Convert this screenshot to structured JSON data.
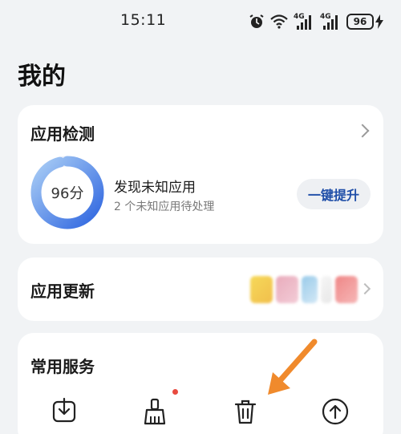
{
  "status_bar": {
    "time": "15:11",
    "icons": [
      "alarm-icon",
      "wifi-icon",
      "signal-4g-icon",
      "signal-4g-icon",
      "charging-icon"
    ],
    "signal_label_1": "4G",
    "signal_label_2": "4G",
    "battery": "96"
  },
  "page": {
    "title": "我的"
  },
  "app_detect": {
    "title": "应用检测",
    "score_label": "96分",
    "score_value": 96,
    "headline": "发现未知应用",
    "subtext": "2 个未知应用待处理",
    "button_label": "一键提升",
    "colors": {
      "gauge_start": "#2f66e0",
      "gauge_end": "#a9cdf5",
      "button_text": "#1f4ea8"
    }
  },
  "app_update": {
    "title": "应用更新",
    "app_icons": [
      "blurred-app-icon",
      "blurred-app-icon",
      "blurred-app-icon",
      "blurred-app-icon",
      "blurred-app-icon"
    ]
  },
  "services": {
    "title": "常用服务",
    "items": [
      "download-icon",
      "cleanup-brush-icon",
      "trash-icon",
      "upload-icon"
    ],
    "badge_color": "#e84a3f"
  },
  "annotation": {
    "arrow_color": "#f08a2c"
  }
}
